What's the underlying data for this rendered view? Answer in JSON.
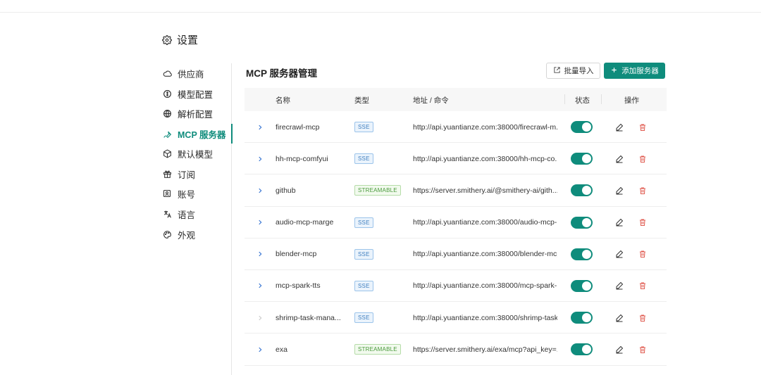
{
  "page": {
    "title": "设置"
  },
  "sidebar": {
    "items": [
      {
        "label": "供应商",
        "icon": "cloud-icon"
      },
      {
        "label": "模型配置",
        "icon": "model-config-icon"
      },
      {
        "label": "解析配置",
        "icon": "globe-icon"
      },
      {
        "label": "MCP 服务器",
        "icon": "wrench-icon",
        "active": true
      },
      {
        "label": "默认模型",
        "icon": "cube-icon"
      },
      {
        "label": "订阅",
        "icon": "gift-icon"
      },
      {
        "label": "账号",
        "icon": "account-icon"
      },
      {
        "label": "语言",
        "icon": "translate-icon"
      },
      {
        "label": "外观",
        "icon": "palette-icon"
      }
    ]
  },
  "main": {
    "title": "MCP 服务器管理",
    "import_label": "批量导入",
    "add_label": "添加服务器"
  },
  "table": {
    "columns": {
      "name": "名称",
      "type": "类型",
      "address": "地址 / 命令",
      "status": "状态",
      "actions": "操作"
    },
    "rows": [
      {
        "name": "firecrawl-mcp",
        "type": "SSE",
        "address": "http://api.yuantianze.com:38000/firecrawl-m...",
        "enabled": true
      },
      {
        "name": "hh-mcp-comfyui",
        "type": "SSE",
        "address": "http://api.yuantianze.com:38000/hh-mcp-co...",
        "enabled": true
      },
      {
        "name": "github",
        "type": "STREAMABLE",
        "address": "https://server.smithery.ai/@smithery-ai/gith...",
        "enabled": true
      },
      {
        "name": "audio-mcp-marge",
        "type": "SSE",
        "address": "http://api.yuantianze.com:38000/audio-mcp-...",
        "enabled": true
      },
      {
        "name": "blender-mcp",
        "type": "SSE",
        "address": "http://api.yuantianze.com:38000/blender-mcp",
        "enabled": true
      },
      {
        "name": "mcp-spark-tts",
        "type": "SSE",
        "address": "http://api.yuantianze.com:38000/mcp-spark-...",
        "enabled": true
      },
      {
        "name": "shrimp-task-mana...",
        "type": "SSE",
        "address": "http://api.yuantianze.com:38000/shrimp-task...",
        "enabled": true,
        "expand_disabled": true
      },
      {
        "name": "exa",
        "type": "STREAMABLE",
        "address": "https://server.smithery.ai/exa/mcp?api_key=...",
        "enabled": true
      }
    ]
  },
  "colors": {
    "accent": "#0f8c7c",
    "danger": "#e05a4f",
    "sse": "#3f7fbf",
    "streamable": "#4a9a3c"
  }
}
